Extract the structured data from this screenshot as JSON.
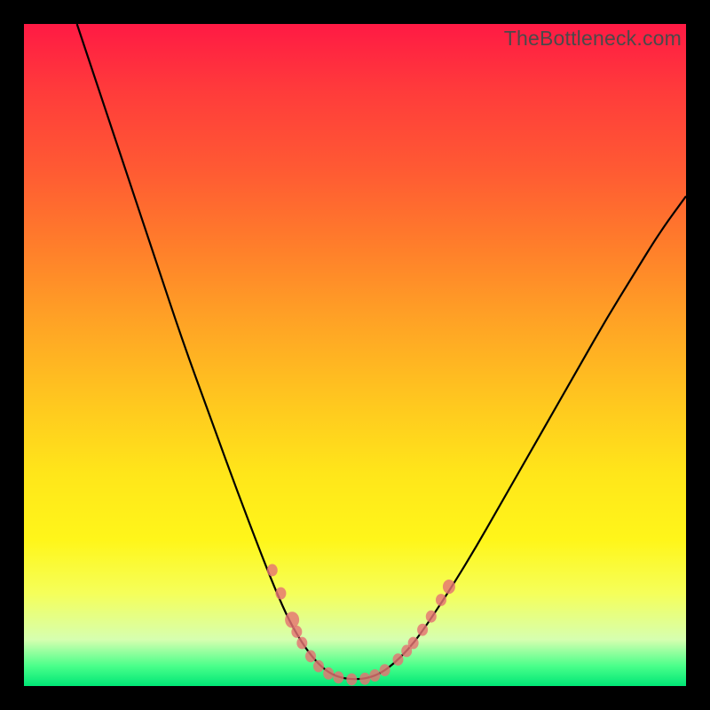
{
  "watermark": "TheBottleneck.com",
  "chart_data": {
    "type": "line",
    "title": "",
    "xlabel": "",
    "ylabel": "",
    "xlim": [
      0,
      100
    ],
    "ylim": [
      0,
      100
    ],
    "curve": [
      {
        "x": 8.0,
        "y": 100.0
      },
      {
        "x": 12.0,
        "y": 88.0
      },
      {
        "x": 16.0,
        "y": 76.0
      },
      {
        "x": 20.0,
        "y": 64.0
      },
      {
        "x": 24.0,
        "y": 52.0
      },
      {
        "x": 28.0,
        "y": 41.0
      },
      {
        "x": 32.0,
        "y": 30.0
      },
      {
        "x": 36.0,
        "y": 19.5
      },
      {
        "x": 38.0,
        "y": 14.5
      },
      {
        "x": 40.0,
        "y": 10.0
      },
      {
        "x": 42.0,
        "y": 6.5
      },
      {
        "x": 44.0,
        "y": 3.8
      },
      {
        "x": 46.0,
        "y": 2.0
      },
      {
        "x": 48.0,
        "y": 1.2
      },
      {
        "x": 50.0,
        "y": 1.0
      },
      {
        "x": 52.0,
        "y": 1.2
      },
      {
        "x": 54.0,
        "y": 2.0
      },
      {
        "x": 56.0,
        "y": 3.5
      },
      {
        "x": 58.0,
        "y": 5.5
      },
      {
        "x": 60.0,
        "y": 8.0
      },
      {
        "x": 64.0,
        "y": 14.0
      },
      {
        "x": 68.0,
        "y": 20.5
      },
      {
        "x": 72.0,
        "y": 27.5
      },
      {
        "x": 76.0,
        "y": 34.5
      },
      {
        "x": 80.0,
        "y": 41.5
      },
      {
        "x": 84.0,
        "y": 48.5
      },
      {
        "x": 88.0,
        "y": 55.5
      },
      {
        "x": 92.0,
        "y": 62.0
      },
      {
        "x": 96.0,
        "y": 68.5
      },
      {
        "x": 100.0,
        "y": 74.0
      }
    ],
    "markers": [
      {
        "x": 37.5,
        "y": 17.5,
        "r": 6
      },
      {
        "x": 38.8,
        "y": 14.0,
        "r": 6
      },
      {
        "x": 40.5,
        "y": 10.0,
        "r": 8
      },
      {
        "x": 41.2,
        "y": 8.2,
        "r": 6
      },
      {
        "x": 42.0,
        "y": 6.5,
        "r": 6
      },
      {
        "x": 43.3,
        "y": 4.5,
        "r": 6
      },
      {
        "x": 44.5,
        "y": 3.0,
        "r": 6
      },
      {
        "x": 46.0,
        "y": 1.9,
        "r": 6
      },
      {
        "x": 47.5,
        "y": 1.3,
        "r": 6
      },
      {
        "x": 49.5,
        "y": 1.0,
        "r": 6
      },
      {
        "x": 51.5,
        "y": 1.1,
        "r": 6
      },
      {
        "x": 53.0,
        "y": 1.6,
        "r": 6
      },
      {
        "x": 54.5,
        "y": 2.4,
        "r": 6
      },
      {
        "x": 56.5,
        "y": 4.0,
        "r": 6
      },
      {
        "x": 57.8,
        "y": 5.3,
        "r": 6
      },
      {
        "x": 58.8,
        "y": 6.5,
        "r": 6
      },
      {
        "x": 60.2,
        "y": 8.5,
        "r": 6
      },
      {
        "x": 61.5,
        "y": 10.5,
        "r": 6
      },
      {
        "x": 63.0,
        "y": 13.0,
        "r": 6
      },
      {
        "x": 64.2,
        "y": 15.0,
        "r": 7
      }
    ]
  }
}
